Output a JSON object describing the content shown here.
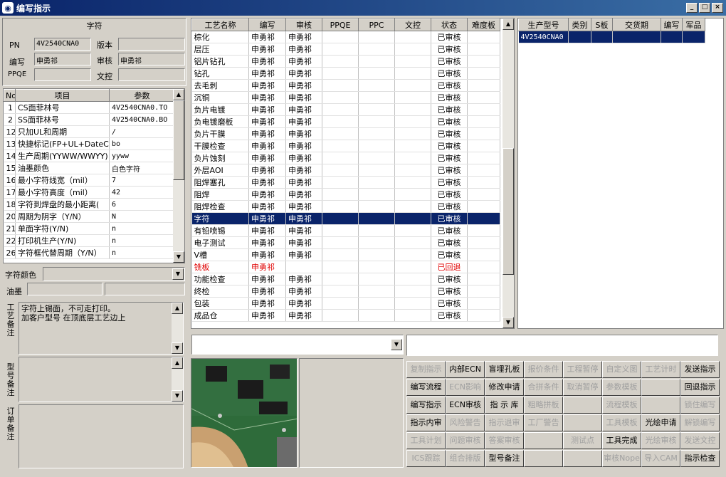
{
  "window": {
    "title": "编写指示"
  },
  "left": {
    "group_title": "字符",
    "fields": {
      "pn_label": "PN",
      "pn_value": "4V2540CNA0",
      "version_label": "版本",
      "version_value": "",
      "writer_label": "编写",
      "writer_value": "申勇祁",
      "reviewer_label": "审核",
      "reviewer_value": "申勇祁",
      "ppqe_label": "PPQE",
      "ppqe_value": "",
      "doc_label": "文控",
      "doc_value": ""
    },
    "param_table": {
      "headers": [
        "No",
        "项目",
        "参数"
      ],
      "rows": [
        [
          "1",
          "CS面菲林号",
          "4V2540CNA0.TO"
        ],
        [
          "2",
          "SS面菲林号",
          "4V2540CNA0.BO"
        ],
        [
          "12",
          "只加UL和周期",
          "/"
        ],
        [
          "13",
          "快捷标记(FP+UL+DateCo",
          "bo"
        ],
        [
          "14",
          "生产周期(YYWW/WWYY)",
          "yyww"
        ],
        [
          "15",
          "油墨颜色",
          "白色字符"
        ],
        [
          "16",
          "最小字符线宽（mil）",
          "7"
        ],
        [
          "17",
          "最小字符高度（mil）",
          "42"
        ],
        [
          "18",
          "字符到焊盘的最小距离(",
          "6"
        ],
        [
          "20",
          "周期为阴字（Y/N）",
          "N"
        ],
        [
          "21",
          "单面字符(Y/N)",
          "n"
        ],
        [
          "22",
          "打印机生产(Y/N)",
          "n"
        ],
        [
          "26",
          "字符框代替周期（Y/N）",
          "n"
        ]
      ]
    },
    "char_color_label": "字符颜色",
    "char_color_value": "",
    "ink_label": "油墨",
    "process_note_label": "工艺备注",
    "process_note_text": [
      "字符上锡面，不可走打印。",
      "加客户型号 在顶底层工艺边上"
    ],
    "model_note_label": "型号备注",
    "order_note_label": "订单备注"
  },
  "process_table": {
    "headers": [
      "工艺名称",
      "编写",
      "审核",
      "PPQE",
      "PPC",
      "文控",
      "状态",
      "难度板"
    ],
    "rows": [
      [
        "棕化",
        "申勇祁",
        "申勇祁",
        "",
        "",
        "",
        "已审核",
        ""
      ],
      [
        "层压",
        "申勇祁",
        "申勇祁",
        "",
        "",
        "",
        "已审核",
        ""
      ],
      [
        "铝片钻孔",
        "申勇祁",
        "申勇祁",
        "",
        "",
        "",
        "已审核",
        ""
      ],
      [
        "钻孔",
        "申勇祁",
        "申勇祁",
        "",
        "",
        "",
        "已审核",
        ""
      ],
      [
        "去毛刺",
        "申勇祁",
        "申勇祁",
        "",
        "",
        "",
        "已审核",
        ""
      ],
      [
        "沉铜",
        "申勇祁",
        "申勇祁",
        "",
        "",
        "",
        "已审核",
        ""
      ],
      [
        "负片电镀",
        "申勇祁",
        "申勇祁",
        "",
        "",
        "",
        "已审核",
        ""
      ],
      [
        "负电镀磨板",
        "申勇祁",
        "申勇祁",
        "",
        "",
        "",
        "已审核",
        ""
      ],
      [
        "负片干膜",
        "申勇祁",
        "申勇祁",
        "",
        "",
        "",
        "已审核",
        ""
      ],
      [
        "干膜检查",
        "申勇祁",
        "申勇祁",
        "",
        "",
        "",
        "已审核",
        ""
      ],
      [
        "负片蚀刻",
        "申勇祁",
        "申勇祁",
        "",
        "",
        "",
        "已审核",
        ""
      ],
      [
        "外层AOI",
        "申勇祁",
        "申勇祁",
        "",
        "",
        "",
        "已审核",
        ""
      ],
      [
        "阻焊塞孔",
        "申勇祁",
        "申勇祁",
        "",
        "",
        "",
        "已审核",
        ""
      ],
      [
        "阻焊",
        "申勇祁",
        "申勇祁",
        "",
        "",
        "",
        "已审核",
        ""
      ],
      [
        "阻焊检查",
        "申勇祁",
        "申勇祁",
        "",
        "",
        "",
        "已审核",
        ""
      ],
      [
        "字符",
        "申勇祁",
        "申勇祁",
        "",
        "",
        "",
        "已审核",
        ""
      ],
      [
        "有铅喷锡",
        "申勇祁",
        "申勇祁",
        "",
        "",
        "",
        "已审核",
        ""
      ],
      [
        "电子测试",
        "申勇祁",
        "申勇祁",
        "",
        "",
        "",
        "已审核",
        ""
      ],
      [
        "V槽",
        "申勇祁",
        "申勇祁",
        "",
        "",
        "",
        "已审核",
        ""
      ],
      [
        "铣板",
        "申勇祁",
        "",
        "",
        "",
        "",
        "已回退",
        ""
      ],
      [
        "功能检查",
        "申勇祁",
        "申勇祁",
        "",
        "",
        "",
        "已审核",
        ""
      ],
      [
        "终检",
        "申勇祁",
        "申勇祁",
        "",
        "",
        "",
        "已审核",
        ""
      ],
      [
        "包装",
        "申勇祁",
        "申勇祁",
        "",
        "",
        "",
        "已审核",
        ""
      ],
      [
        "成品仓",
        "申勇祁",
        "申勇祁",
        "",
        "",
        "",
        "已审核",
        ""
      ]
    ],
    "selected_index": 15,
    "returned_index": 19
  },
  "product_table": {
    "headers": [
      "生产型号",
      "类别",
      "S板",
      "交货期",
      "编写",
      "军品"
    ],
    "rows": [
      [
        "4V2540CNA0",
        "",
        "",
        "",
        "",
        ""
      ]
    ]
  },
  "buttons": [
    [
      {
        "label": "复制指示",
        "enabled": false
      },
      {
        "label": "内部ECN",
        "enabled": true
      },
      {
        "label": "盲埋孔板",
        "enabled": true
      },
      {
        "label": "报价条件",
        "enabled": false
      },
      {
        "label": "工程暂停",
        "enabled": false
      },
      {
        "label": "自定义图",
        "enabled": false
      },
      {
        "label": "工艺计时",
        "enabled": false
      },
      {
        "label": "发送指示",
        "enabled": true
      }
    ],
    [
      {
        "label": "编写流程",
        "enabled": true
      },
      {
        "label": "ECN影响",
        "enabled": false
      },
      {
        "label": "修改申请",
        "enabled": true
      },
      {
        "label": "合拼条件",
        "enabled": false
      },
      {
        "label": "取消暂停",
        "enabled": false
      },
      {
        "label": "参数模板",
        "enabled": false
      },
      {
        "label": "",
        "enabled": false
      },
      {
        "label": "回退指示",
        "enabled": true
      }
    ],
    [
      {
        "label": "编写指示",
        "enabled": true
      },
      {
        "label": "ECN审核",
        "enabled": true
      },
      {
        "label": "指 示 库",
        "enabled": true
      },
      {
        "label": "粗略拼板",
        "enabled": false
      },
      {
        "label": "",
        "enabled": false
      },
      {
        "label": "流程模板",
        "enabled": false
      },
      {
        "label": "",
        "enabled": false
      },
      {
        "label": "锁住编写",
        "enabled": false
      }
    ],
    [
      {
        "label": "指示内审",
        "enabled": true
      },
      {
        "label": "风险警告",
        "enabled": false
      },
      {
        "label": "指示退审",
        "enabled": false
      },
      {
        "label": "工厂警告",
        "enabled": false
      },
      {
        "label": "",
        "enabled": false
      },
      {
        "label": "工具模板",
        "enabled": false
      },
      {
        "label": "光绘申请",
        "enabled": true
      },
      {
        "label": "解锁编写",
        "enabled": false
      }
    ],
    [
      {
        "label": "工具计划",
        "enabled": false
      },
      {
        "label": "问题审核",
        "enabled": false
      },
      {
        "label": "答案审核",
        "enabled": false
      },
      {
        "label": "",
        "enabled": false
      },
      {
        "label": "测试点",
        "enabled": false
      },
      {
        "label": "工具完成",
        "enabled": true
      },
      {
        "label": "光绘审核",
        "enabled": false
      },
      {
        "label": "发送文控",
        "enabled": false
      }
    ],
    [
      {
        "label": "ICS跟踪",
        "enabled": false
      },
      {
        "label": "组合排版",
        "enabled": false
      },
      {
        "label": "型号备注",
        "enabled": true
      },
      {
        "label": "",
        "enabled": false
      },
      {
        "label": "",
        "enabled": false
      },
      {
        "label": "审核Nope",
        "enabled": false
      },
      {
        "label": "导入CAM",
        "enabled": false
      },
      {
        "label": "指示检查",
        "enabled": true
      }
    ]
  ]
}
